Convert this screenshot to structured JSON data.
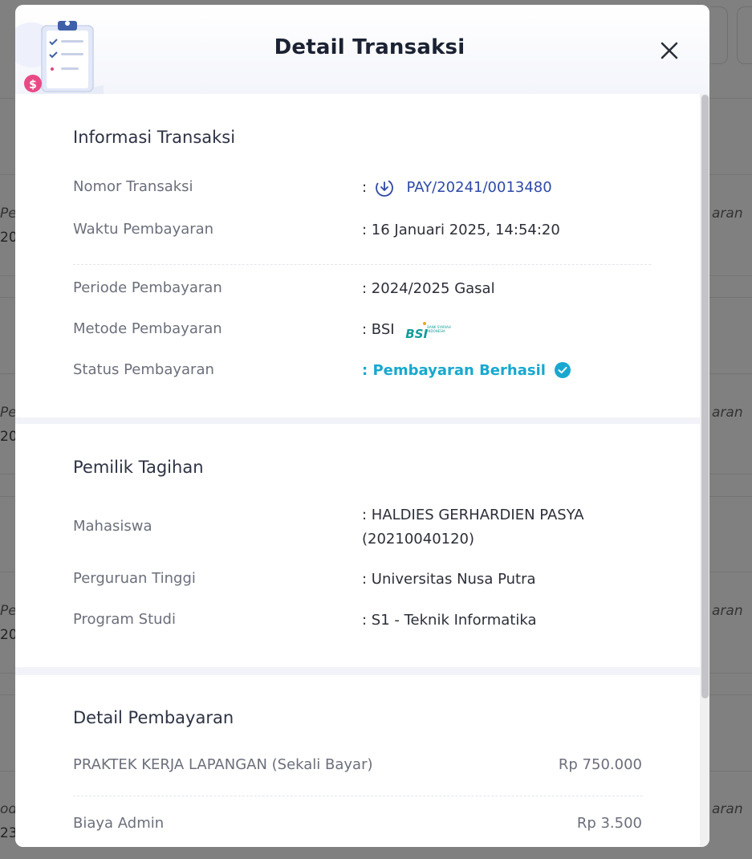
{
  "background": {
    "fragments": [
      "Pe",
      "20",
      "Pe",
      "20",
      "Pe",
      "20",
      "od",
      "23/",
      "aran",
      "aran",
      "aran",
      "aran"
    ]
  },
  "modal": {
    "title": "Detail Transaksi",
    "close_icon": "close-icon"
  },
  "info": {
    "title": "Informasi Transaksi",
    "rows": [
      {
        "label": "Nomor Transaksi",
        "value": "PAY/20241/0013480",
        "prefix": ":"
      },
      {
        "label": "Waktu Pembayaran",
        "value": ": 16 Januari 2025, 14:54:20"
      },
      {
        "label": "Periode Pembayaran",
        "value": ": 2024/2025 Gasal"
      },
      {
        "label": "Metode Pembayaran",
        "value": ": BSI"
      },
      {
        "label": "Status Pembayaran",
        "value": ": Pembayaran Berhasil"
      }
    ],
    "bank_logo": {
      "text": "BSI",
      "subtext": "BANK SYARIAH INDONESIA"
    }
  },
  "owner": {
    "title": "Pemilik Tagihan",
    "rows": [
      {
        "label": "Mahasiswa",
        "value_line1": ": HALDIES GERHARDIEN PASYA",
        "value_line2": "(20210040120)"
      },
      {
        "label": "Perguruan Tinggi",
        "value": ": Universitas Nusa Putra"
      },
      {
        "label": "Program Studi",
        "value": ": S1 - Teknik Informatika"
      }
    ]
  },
  "payment": {
    "title": "Detail Pembayaran",
    "items": [
      {
        "label": "PRAKTEK KERJA LAPANGAN (Sekali Bayar)",
        "amount": "Rp 750.000"
      },
      {
        "label": "Biaya Admin",
        "amount": "Rp 3.500"
      }
    ]
  },
  "colors": {
    "link": "#2f49a8",
    "status": "#18a8cf",
    "overlay": "#808080"
  }
}
